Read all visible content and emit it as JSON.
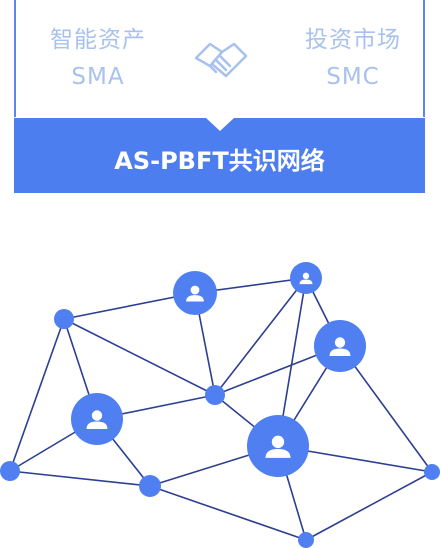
{
  "header": {
    "left_party": {
      "name": "智能资产",
      "code": "SMA"
    },
    "right_party": {
      "name": "投资市场",
      "code": "SMC"
    },
    "center_icon": "handshake-icon",
    "banner_title": "AS-PBFT共识网络"
  },
  "colors": {
    "accent": "#4d7ef0",
    "border": "#5b86f0",
    "faded_text": "#a9c1ef",
    "node": "#4f7ff1",
    "edge": "#2d3f8f"
  },
  "network": {
    "node_icon": "user-icon",
    "nodes": [
      {
        "id": "n1",
        "type": "small"
      },
      {
        "id": "n2",
        "type": "user"
      },
      {
        "id": "n3",
        "type": "user"
      },
      {
        "id": "n4",
        "type": "user"
      },
      {
        "id": "n5",
        "type": "small"
      },
      {
        "id": "n6",
        "type": "user"
      },
      {
        "id": "n7",
        "type": "user"
      },
      {
        "id": "n8",
        "type": "small"
      },
      {
        "id": "n9",
        "type": "small"
      },
      {
        "id": "n10",
        "type": "small"
      },
      {
        "id": "n11",
        "type": "small"
      }
    ],
    "edges": [
      [
        "n1",
        "n2"
      ],
      [
        "n1",
        "n5"
      ],
      [
        "n1",
        "n6"
      ],
      [
        "n1",
        "n8"
      ],
      [
        "n2",
        "n3"
      ],
      [
        "n2",
        "n5"
      ],
      [
        "n3",
        "n4"
      ],
      [
        "n3",
        "n5"
      ],
      [
        "n3",
        "n7"
      ],
      [
        "n4",
        "n5"
      ],
      [
        "n4",
        "n7"
      ],
      [
        "n4",
        "n11"
      ],
      [
        "n5",
        "n6"
      ],
      [
        "n5",
        "n7"
      ],
      [
        "n6",
        "n8"
      ],
      [
        "n6",
        "n9"
      ],
      [
        "n7",
        "n9"
      ],
      [
        "n7",
        "n10"
      ],
      [
        "n7",
        "n11"
      ],
      [
        "n8",
        "n9"
      ],
      [
        "n9",
        "n10"
      ],
      [
        "n10",
        "n11"
      ]
    ]
  }
}
